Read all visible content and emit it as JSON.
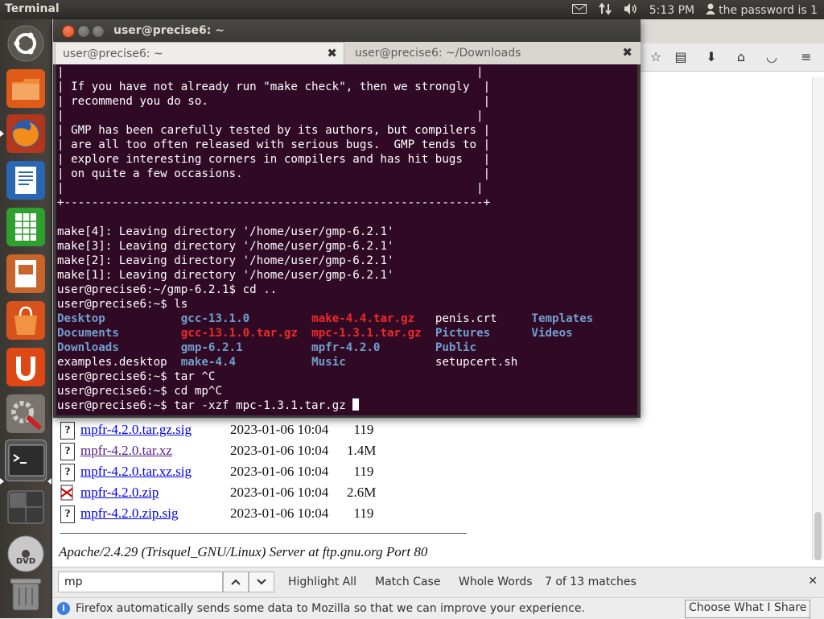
{
  "topbar": {
    "app_title": "Terminal",
    "time": "5:13 PM",
    "user_label": "the password is 1",
    "icons": [
      "mail-icon",
      "network-icon",
      "volume-icon",
      "user-icon"
    ]
  },
  "launcher": {
    "items": [
      "dash-home",
      "files",
      "firefox",
      "libreoffice-writer",
      "libreoffice-calc",
      "libreoffice-impress",
      "software-center",
      "ubuntu-one",
      "system-settings",
      "terminal",
      "workspace-switcher",
      "dvd",
      "trash"
    ],
    "dvd_label": "DVD"
  },
  "terminal": {
    "window_title": "user@precise6: ~",
    "tabs": [
      {
        "label": "user@precise6: ~",
        "active": true
      },
      {
        "label": "user@precise6: ~/Downloads",
        "active": false
      }
    ],
    "close_glyph": "✖",
    "box_lines": [
      "|                                                            |",
      "| If you have not already run \"make check\", then we strongly  |",
      "| recommend you do so.                                        |",
      "|                                                            |",
      "| GMP has been carefully tested by its authors, but compilers |",
      "| are all too often released with serious bugs.  GMP tends to |",
      "| explore interesting corners in compilers and has hit bugs   |",
      "| on quite a few occasions.                                   |",
      "|                                                            |",
      "+-------------------------------------------------------------+"
    ],
    "lines": [
      "",
      "make[4]: Leaving directory '/home/user/gmp-6.2.1'",
      "make[3]: Leaving directory '/home/user/gmp-6.2.1'",
      "make[2]: Leaving directory '/home/user/gmp-6.2.1'",
      "make[1]: Leaving directory '/home/user/gmp-6.2.1'",
      "user@precise6:~/gmp-6.2.1$ cd ..",
      "user@precise6:~$ ls"
    ],
    "ls_output": [
      [
        {
          "t": "Desktop",
          "c": "blue"
        },
        {
          "t": "gcc-13.1.0",
          "c": "blue"
        },
        {
          "t": "make-4.4.tar.gz",
          "c": "red"
        },
        {
          "t": "penis.crt",
          "c": ""
        },
        {
          "t": "Templates",
          "c": "blue"
        }
      ],
      [
        {
          "t": "Documents",
          "c": "blue"
        },
        {
          "t": "gcc-13.1.0.tar.gz",
          "c": "red"
        },
        {
          "t": "mpc-1.3.1.tar.gz",
          "c": "red"
        },
        {
          "t": "Pictures",
          "c": "blue"
        },
        {
          "t": "Videos",
          "c": "blue"
        }
      ],
      [
        {
          "t": "Downloads",
          "c": "blue"
        },
        {
          "t": "gmp-6.2.1",
          "c": "blue"
        },
        {
          "t": "mpfr-4.2.0",
          "c": "blue"
        },
        {
          "t": "Public",
          "c": "blue"
        },
        {
          "t": "",
          "c": ""
        }
      ],
      [
        {
          "t": "examples.desktop",
          "c": ""
        },
        {
          "t": "make-4.4",
          "c": "blue"
        },
        {
          "t": "Music",
          "c": "blue"
        },
        {
          "t": "setupcert.sh",
          "c": ""
        },
        {
          "t": "",
          "c": ""
        }
      ]
    ],
    "after_lines": [
      "user@precise6:~$ tar ^C",
      "user@precise6:~$ cd mp^C",
      "user@precise6:~$ tar -xzf mpc-1.3.1.tar.gz "
    ]
  },
  "firefox": {
    "files": [
      {
        "name": "mpfr-4.2.0.tar.gz.sig",
        "date": "2023-01-06 10:04",
        "size": "119",
        "icon": "?",
        "visited": false
      },
      {
        "name": "mpfr-4.2.0.tar.xz",
        "date": "2023-01-06 10:04",
        "size": "1.4M",
        "icon": "?",
        "visited": true
      },
      {
        "name": "mpfr-4.2.0.tar.xz.sig",
        "date": "2023-01-06 10:04",
        "size": "119",
        "icon": "?",
        "visited": false
      },
      {
        "name": "mpfr-4.2.0.zip",
        "date": "2023-01-06 10:04",
        "size": "2.6M",
        "icon": "zip",
        "visited": false
      },
      {
        "name": "mpfr-4.2.0.zip.sig",
        "date": "2023-01-06 10:04",
        "size": "119",
        "icon": "?",
        "visited": false
      }
    ],
    "server_address": "Apache/2.4.29 (Trisquel_GNU/Linux) Server at ftp.gnu.org Port 80",
    "toolbar_icons": [
      "star-icon",
      "reading-list-icon",
      "download-icon",
      "home-icon",
      "pocket-icon",
      "menu-icon"
    ],
    "findbar": {
      "query": "mp",
      "highlight_all": "Highlight All",
      "match_case": "Match Case",
      "whole_words": "Whole Words",
      "status": "7 of 13 matches",
      "close": "✕"
    },
    "notification": {
      "message": "Firefox automatically sends some data to Mozilla so that we can improve your experience.",
      "button": "Choose What I Share"
    }
  }
}
